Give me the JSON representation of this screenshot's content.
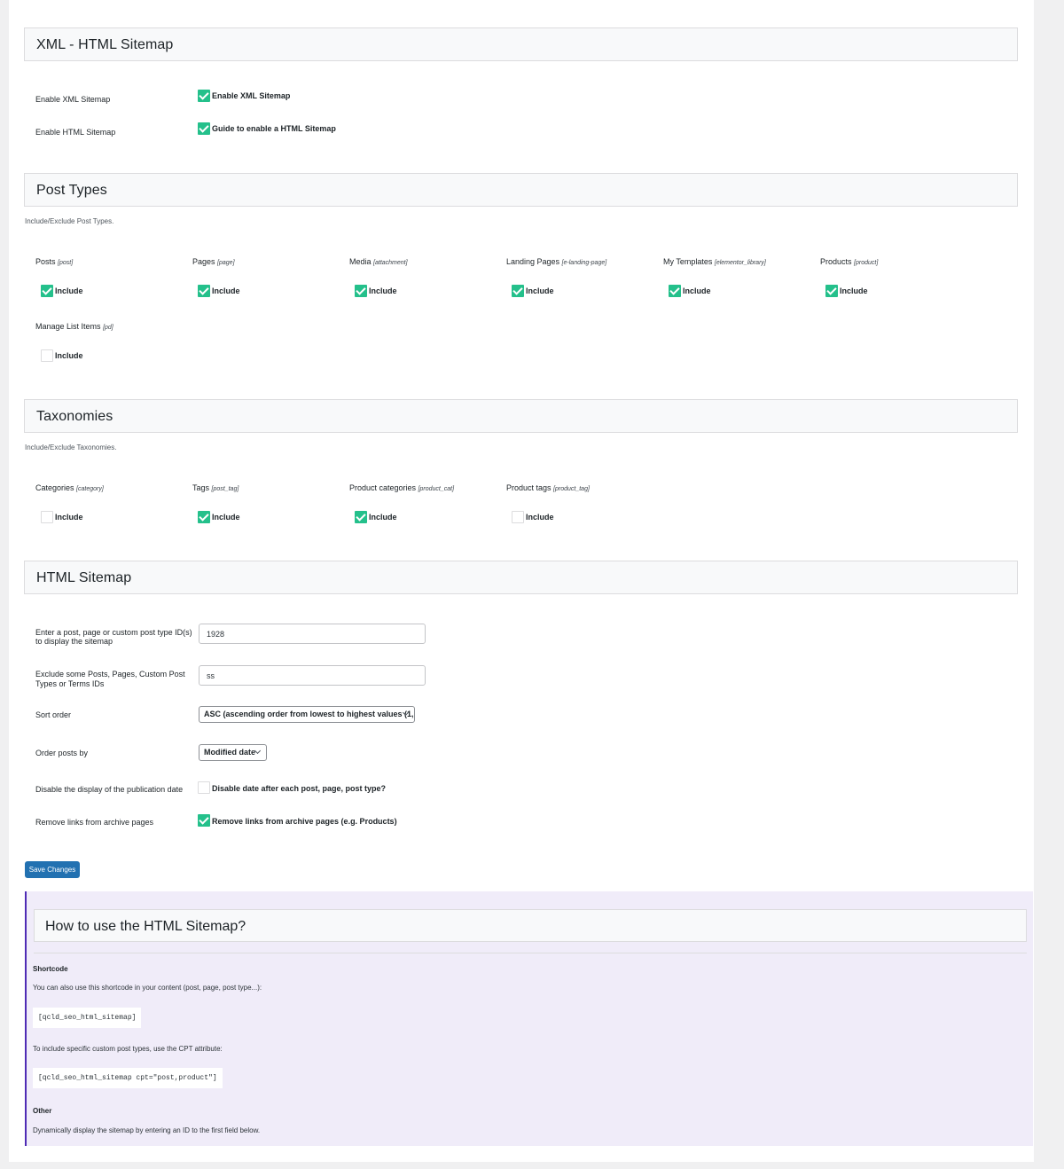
{
  "sections": {
    "xml_html": {
      "title": "XML - HTML Sitemap",
      "rows": [
        {
          "label": "Enable XML Sitemap",
          "checkbox_label": "Enable XML Sitemap",
          "checked": true
        },
        {
          "label": "Enable HTML Sitemap",
          "checkbox_label": "Guide to enable a HTML Sitemap",
          "checked": true
        }
      ]
    },
    "post_types": {
      "title": "Post Types",
      "description": "Include/Exclude Post Types.",
      "items": [
        {
          "name": "Posts",
          "slug": "[post]",
          "include": "Include",
          "checked": true
        },
        {
          "name": "Pages",
          "slug": "[page]",
          "include": "Include",
          "checked": true
        },
        {
          "name": "Media",
          "slug": "[attachment]",
          "include": "Include",
          "checked": true
        },
        {
          "name": "Landing Pages",
          "slug": "[e-landing-page]",
          "include": "Include",
          "checked": true
        },
        {
          "name": "My Templates",
          "slug": "[elementor_library]",
          "include": "Include",
          "checked": true
        },
        {
          "name": "Products",
          "slug": "[product]",
          "include": "Include",
          "checked": true
        },
        {
          "name": "Manage List Items",
          "slug": "[pd]",
          "include": "Include",
          "checked": false
        }
      ]
    },
    "taxonomies": {
      "title": "Taxonomies",
      "description": "Include/Exclude Taxonomies.",
      "items": [
        {
          "name": "Categories",
          "slug": "[category]",
          "include": "Include",
          "checked": false
        },
        {
          "name": "Tags",
          "slug": "[post_tag]",
          "include": "Include",
          "checked": true
        },
        {
          "name": "Product categories",
          "slug": "[product_cat]",
          "include": "Include",
          "checked": true
        },
        {
          "name": "Product tags",
          "slug": "[product_tag]",
          "include": "Include",
          "checked": false
        }
      ]
    },
    "html_sitemap": {
      "title": "HTML Sitemap",
      "id_label_1": "Enter a post, page or custom post type ID(s)",
      "id_label_2": "to display the sitemap",
      "id_value": "1928",
      "exclude_label_1": "Exclude some Posts, Pages, Custom Post",
      "exclude_label_2": "Types or Terms IDs",
      "exclude_value": "ss",
      "sort_label": "Sort order",
      "sort_value": "ASC (ascending order from lowest to highest values (1, ",
      "order_label": "Order posts by",
      "order_value": "Modified date",
      "disable_date_label": "Disable the display of the publication date",
      "disable_date_checkbox": "Disable date after each post, page, post type?",
      "disable_date_checked": false,
      "remove_links_label": "Remove links from archive pages",
      "remove_links_checkbox": "Remove links from archive pages (e.g. Products)",
      "remove_links_checked": true
    }
  },
  "save_button": "Save Changes",
  "help": {
    "title": "How to use the HTML Sitemap?",
    "shortcode_heading": "Shortcode",
    "shortcode_text": "You can also use this shortcode in your content (post, page, post type...):",
    "shortcode_code": "[qcld_seo_html_sitemap]",
    "cpt_text": "To include specific custom post types, use the CPT attribute:",
    "cpt_code": "[qcld_seo_html_sitemap cpt=\"post,product\"]",
    "other_heading": "Other",
    "other_text": "Dynamically display the sitemap by entering an ID to the first field below."
  },
  "colors": {
    "checkbox_on": "#24c08b",
    "primary_button": "#2271b1",
    "info_background": "#f0ecf9",
    "info_border": "#4f2bb5"
  }
}
